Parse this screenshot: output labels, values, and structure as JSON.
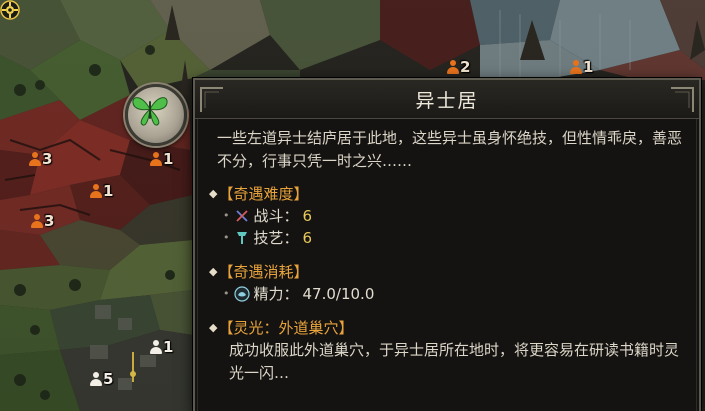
{
  "tooltip": {
    "title": "异士居",
    "description": "一些左道异士结庐居于此地，这些异士虽身怀绝技，但性情乖戾，善恶不分，行事只凭一时之兴……",
    "difficulty": {
      "label": "【奇遇难度】",
      "items": [
        {
          "icon": "crossed-swords-icon",
          "label": "战斗：",
          "value": "6"
        },
        {
          "icon": "tool-icon",
          "label": "技艺：",
          "value": "6"
        }
      ]
    },
    "cost": {
      "label": "【奇遇消耗】",
      "items": [
        {
          "icon": "spirit-energy-icon",
          "label": "精力：",
          "value": "47.0/10.0"
        }
      ]
    },
    "inspiration": {
      "label": "【灵光：外道巢穴】",
      "text": "成功收服此外道巢穴，于异士居所在地时，将更容易在研读书籍时灵光一闪…"
    }
  },
  "map": {
    "markers": [
      {
        "id": "m1",
        "type": "orange",
        "count": "2"
      },
      {
        "id": "m2",
        "type": "orange",
        "count": "1"
      },
      {
        "id": "m3",
        "type": "orange",
        "count": "3"
      },
      {
        "id": "m4",
        "type": "orange",
        "count": "1"
      },
      {
        "id": "m5",
        "type": "orange",
        "count": "1"
      },
      {
        "id": "m6",
        "type": "orange",
        "count": "3"
      },
      {
        "id": "m7",
        "type": "white",
        "count": "1"
      },
      {
        "id": "m8",
        "type": "white",
        "count": "5"
      }
    ],
    "site_icon": "butterfly-icon",
    "colors": {
      "accent_orange": "#e8731d",
      "section_gold": "#e8a33b",
      "value_yellow": "#e7c95a",
      "panel_bg": "#141311",
      "butterfly_green": "#4fbf4a"
    }
  }
}
